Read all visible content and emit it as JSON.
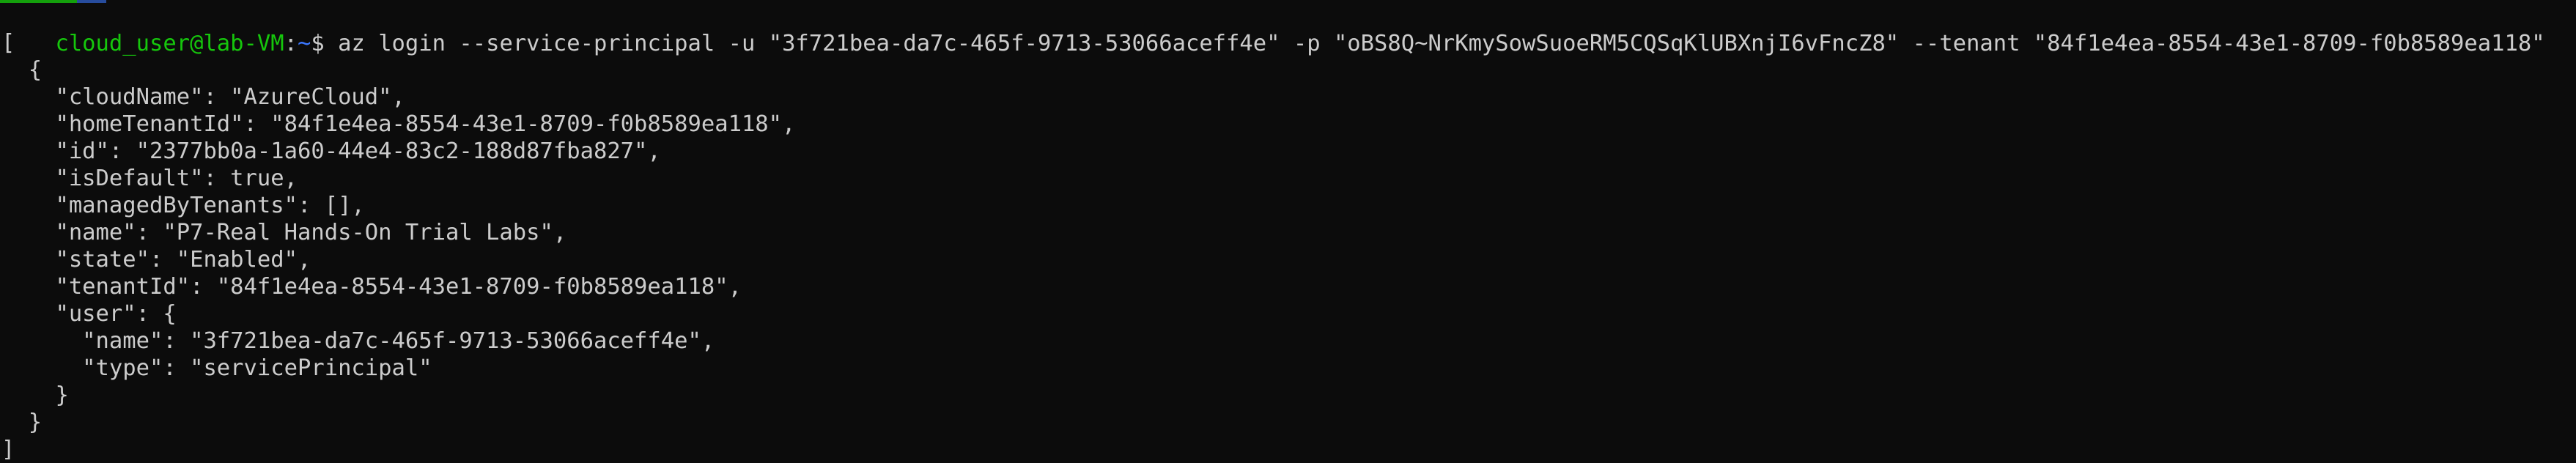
{
  "prompt": {
    "user_host": "cloud_user@lab-VM",
    "separator": ":",
    "path": "~",
    "symbol": "$ "
  },
  "command": "az login --service-principal -u \"3f721bea-da7c-465f-9713-53066aceff4e\" -p \"oBS8Q~NrKmySowSuoeRM5CQSqKlUBXnjI6vFncZ8\" --tenant \"84f1e4ea-8554-43e1-8709-f0b8589ea118\"",
  "output_lines": [
    "[",
    "  {",
    "    \"cloudName\": \"AzureCloud\",",
    "    \"homeTenantId\": \"84f1e4ea-8554-43e1-8709-f0b8589ea118\",",
    "    \"id\": \"2377bb0a-1a60-44e4-83c2-188d87fba827\",",
    "    \"isDefault\": true,",
    "    \"managedByTenants\": [],",
    "    \"name\": \"P7-Real Hands-On Trial Labs\",",
    "    \"state\": \"Enabled\",",
    "    \"tenantId\": \"84f1e4ea-8554-43e1-8709-f0b8589ea118\",",
    "    \"user\": {",
    "      \"name\": \"3f721bea-da7c-465f-9713-53066aceff4e\",",
    "      \"type\": \"servicePrincipal\"",
    "    }",
    "  }",
    "]"
  ],
  "colors": {
    "background": "#0c0c0c",
    "foreground": "#cccccc",
    "prompt_user": "#16c60c",
    "prompt_path": "#3b78ff"
  }
}
